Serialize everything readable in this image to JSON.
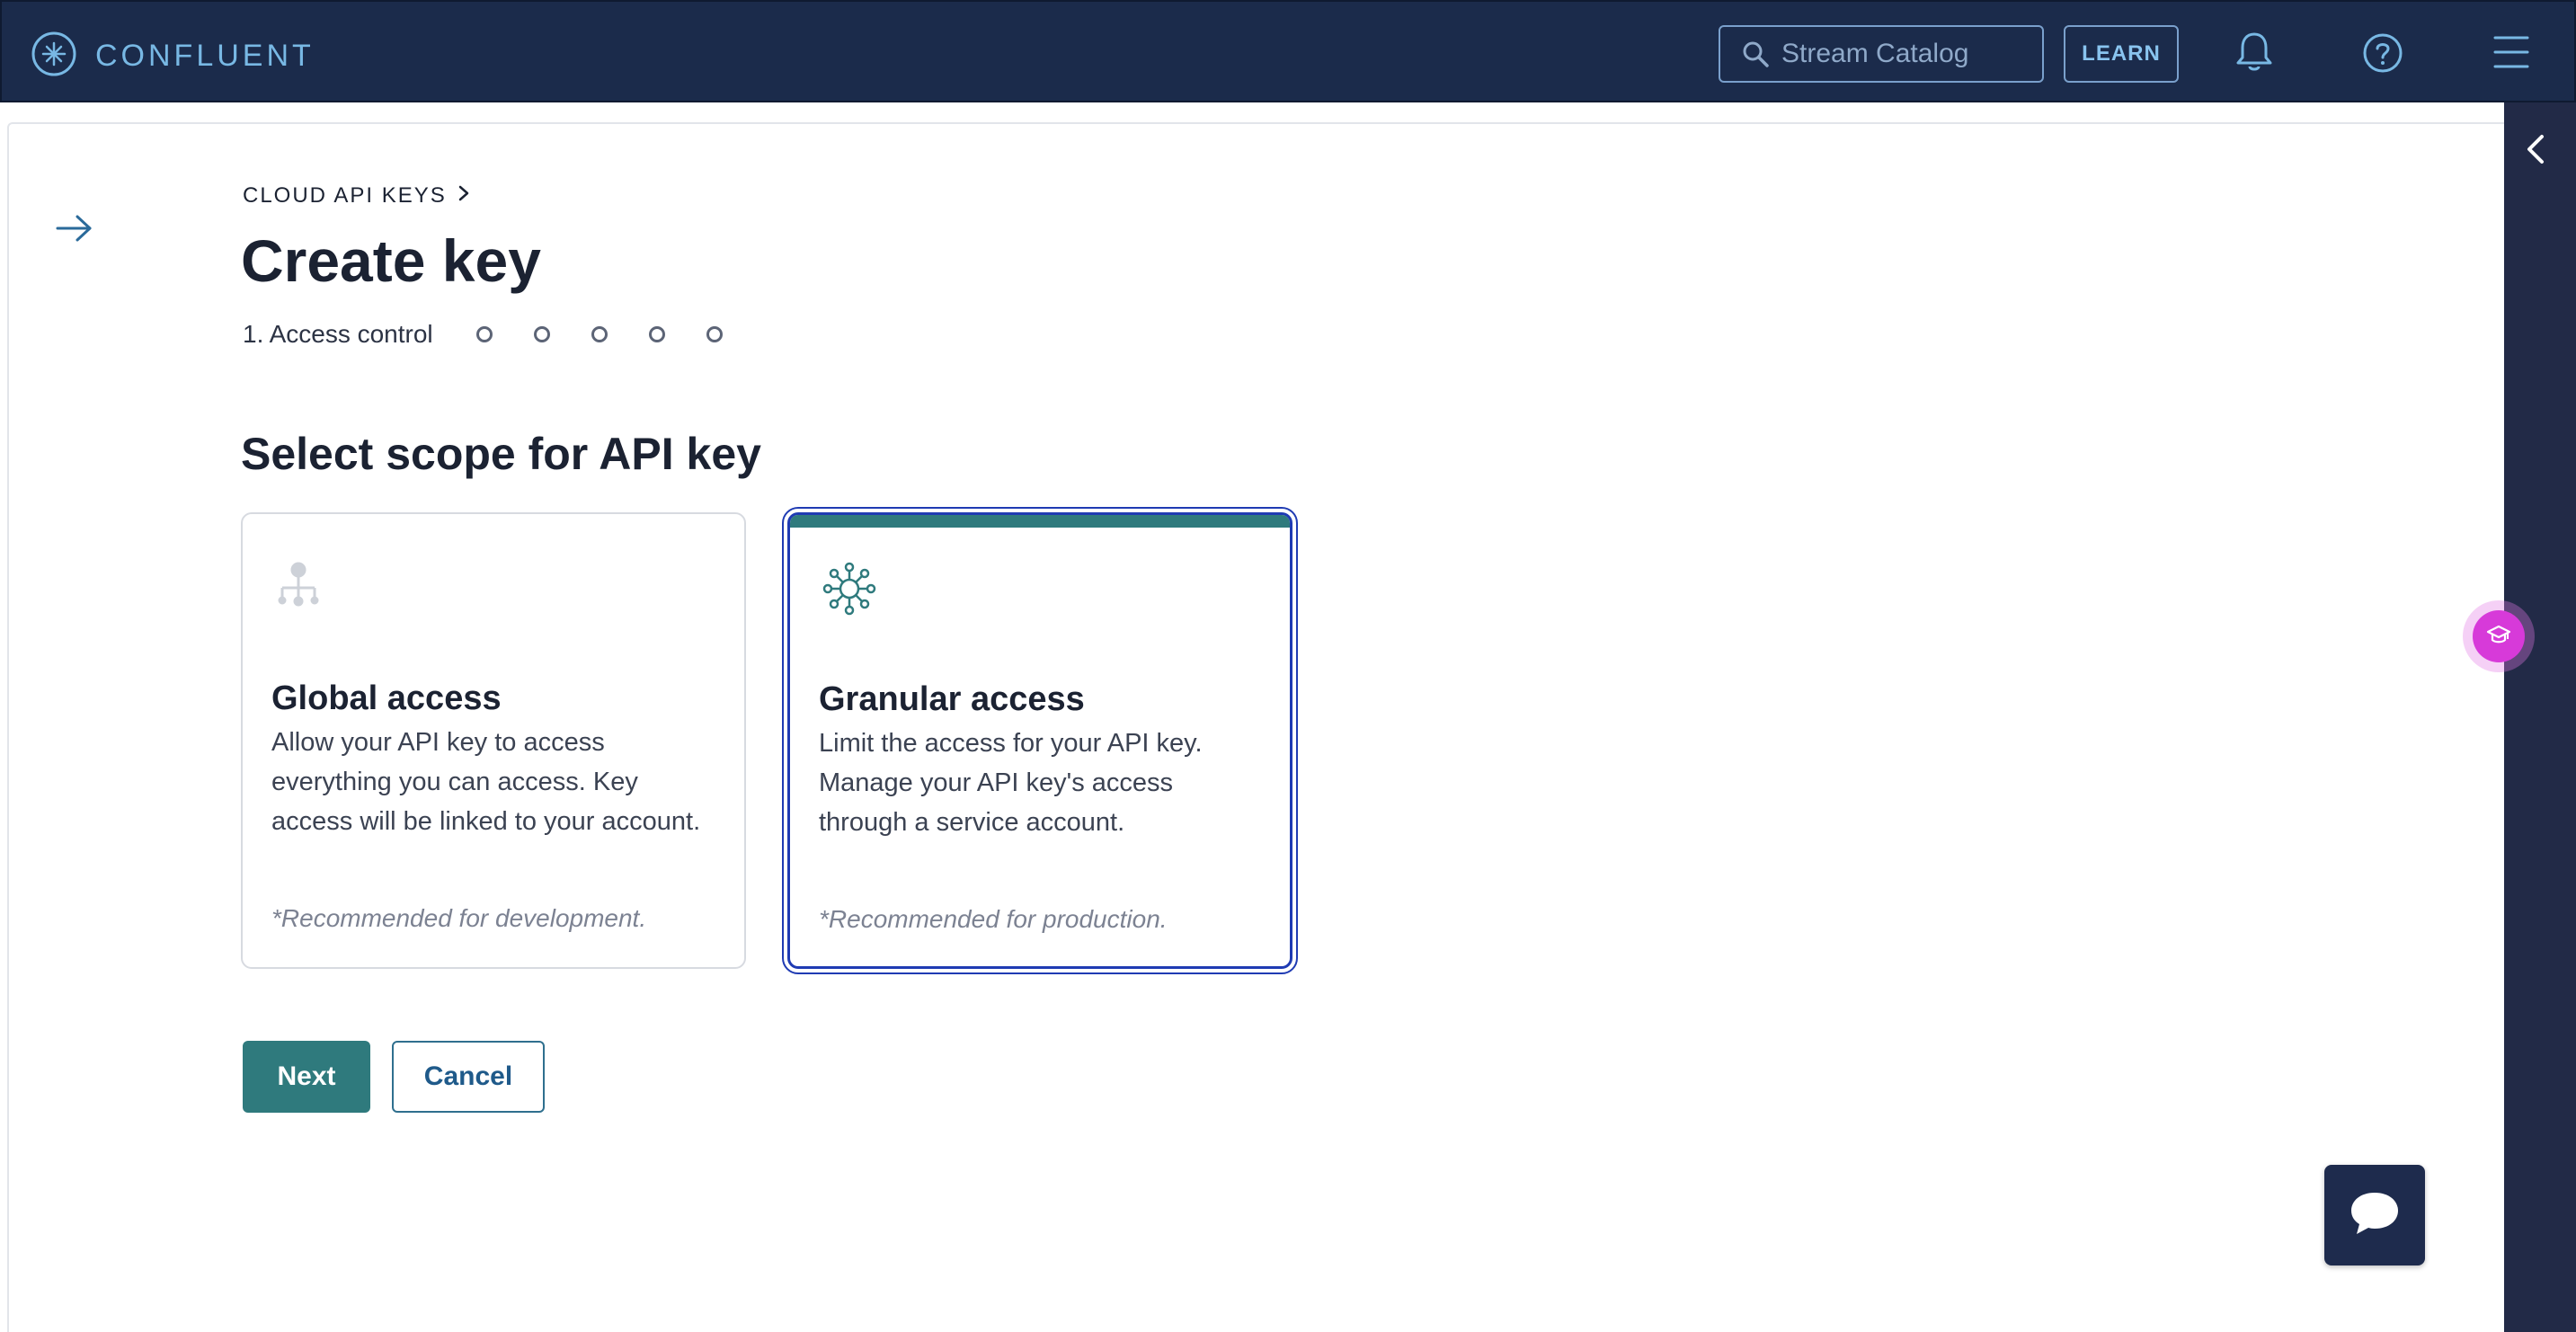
{
  "app": {
    "brand": "CONFLUENT"
  },
  "header": {
    "search_placeholder": "Stream Catalog",
    "learn_label": "LEARN"
  },
  "page": {
    "breadcrumb": "CLOUD API KEYS",
    "title": "Create key",
    "step_label": "1. Access control",
    "remaining_steps": 5,
    "section_title": "Select scope for API key"
  },
  "cards": {
    "global": {
      "title": "Global access",
      "description": "Allow your API key to access everything you can access. Key access will be linked to your account.",
      "note": "*Recommended for development.",
      "selected": false
    },
    "granular": {
      "title": "Granular access",
      "description": "Limit the access for your API key. Manage your API key's access through a service account.",
      "note": "*Recommended for production.",
      "selected": true
    }
  },
  "actions": {
    "next_label": "Next",
    "cancel_label": "Cancel"
  },
  "colors": {
    "topbar": "#1b2b4b",
    "accent_teal": "#2f7a7d",
    "selection_blue": "#1f3bb3",
    "edu_pink": "#d73ad9"
  },
  "icons": [
    "confluent-logo-icon",
    "search-icon",
    "bell-icon",
    "help-icon",
    "hamburger-menu-icon",
    "chevron-left-icon",
    "arrow-right-icon",
    "chevron-right-icon",
    "hierarchy-icon",
    "network-hub-icon",
    "graduation-cap-icon",
    "chat-bubble-icon"
  ]
}
